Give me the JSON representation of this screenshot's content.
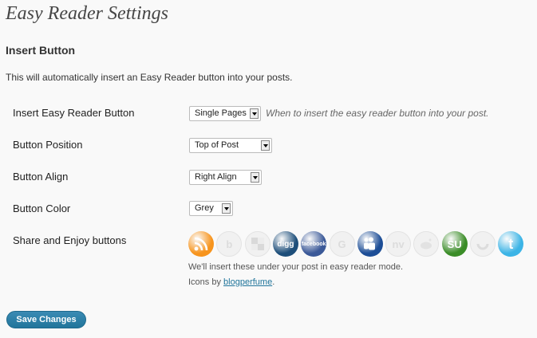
{
  "page": {
    "title": "Easy Reader Settings"
  },
  "section": {
    "title": "Insert Button",
    "description": "This will automatically insert an Easy Reader button into your posts."
  },
  "fields": {
    "insert": {
      "label": "Insert Easy Reader Button",
      "value": "Single Pages",
      "hint": "When to insert the easy reader button into your post."
    },
    "position": {
      "label": "Button Position",
      "value": "Top of Post"
    },
    "align": {
      "label": "Button Align",
      "value": "Right Align"
    },
    "color": {
      "label": "Button Color",
      "value": "Grey"
    },
    "share": {
      "label": "Share and Enjoy buttons"
    }
  },
  "share_icons": [
    {
      "name": "rss-icon",
      "glyph": "",
      "color": "#f7941d",
      "enabled": true
    },
    {
      "name": "bebo-icon",
      "glyph": "b",
      "color": "#e04848",
      "enabled": false
    },
    {
      "name": "delicious-icon",
      "glyph": "",
      "color": "#3274d1",
      "enabled": false
    },
    {
      "name": "digg-icon",
      "glyph": "digg",
      "color": "#1d4e7a",
      "enabled": true
    },
    {
      "name": "facebook-icon",
      "glyph": "facebook",
      "color": "#3b5998",
      "enabled": true
    },
    {
      "name": "google-icon",
      "glyph": "G",
      "color": "#4285f4",
      "enabled": false
    },
    {
      "name": "myspace-icon",
      "glyph": "",
      "color": "#1c4d96",
      "enabled": true
    },
    {
      "name": "netvibes-icon",
      "glyph": "nv",
      "color": "#6aa84f",
      "enabled": false
    },
    {
      "name": "reddit-icon",
      "glyph": "",
      "color": "#ff4500",
      "enabled": false
    },
    {
      "name": "stumbleupon-icon",
      "glyph": "SU",
      "color": "#3b8d28",
      "enabled": true
    },
    {
      "name": "technorati-icon",
      "glyph": "",
      "color": "#4ab34a",
      "enabled": false
    },
    {
      "name": "twitter-icon",
      "glyph": "t",
      "color": "#3cb4e6",
      "enabled": true
    }
  ],
  "notes": {
    "insert_note": "We'll insert these under your post in easy reader mode.",
    "icons_by_prefix": "Icons by ",
    "icons_by_link": "blogperfume",
    "icons_by_suffix": "."
  },
  "buttons": {
    "save": "Save Changes"
  }
}
